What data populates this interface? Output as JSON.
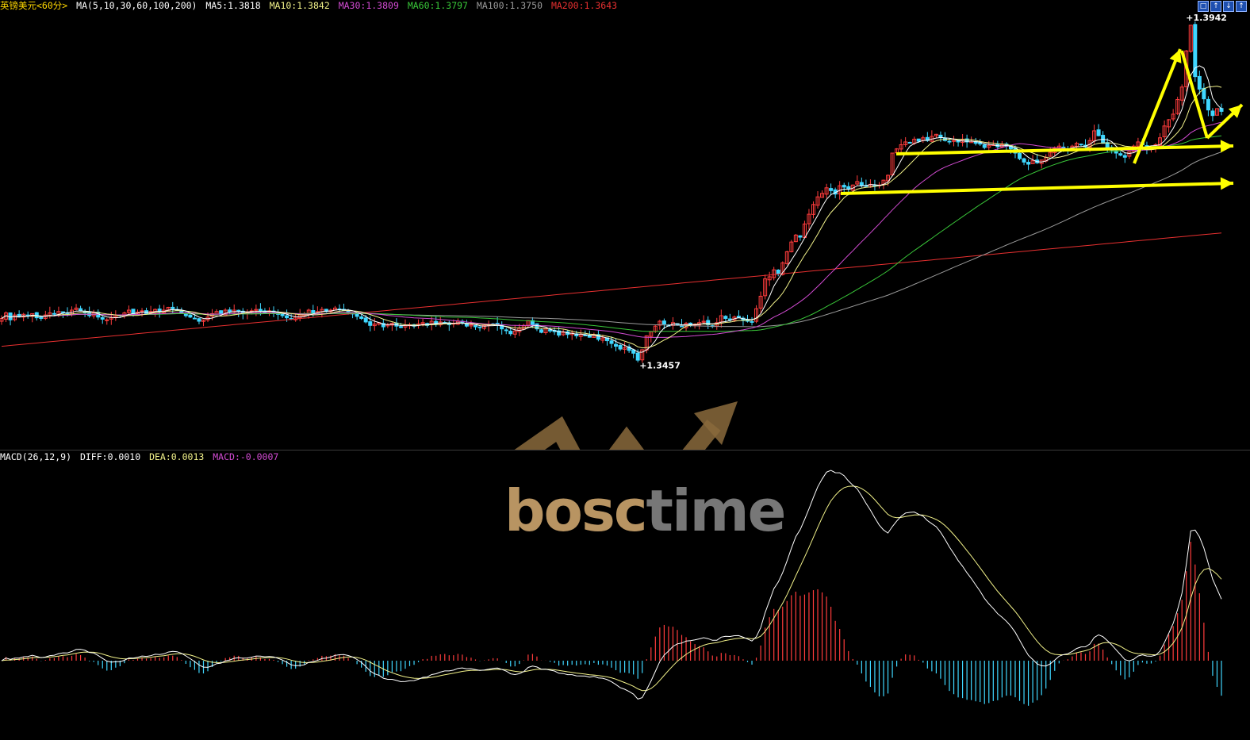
{
  "header": {
    "instrument": "英镑美元<60分>",
    "ma_params": "MA(5,10,30,60,100,200)",
    "ma5": "MA5:1.3818",
    "ma10": "MA10:1.3842",
    "ma30": "MA30:1.3809",
    "ma60": "MA60:1.3797",
    "ma100": "MA100:1.3750",
    "ma200": "MA200:1.3643"
  },
  "macd_header": {
    "params": "MACD(26,12,9)",
    "diff": "DIFF:0.0010",
    "dea": "DEA:0.0013",
    "macd": "MACD:-0.0007"
  },
  "annotations": {
    "high": "1.3942",
    "low": "1.3457"
  },
  "watermark": {
    "text_a": "bosc",
    "text_b": "time"
  },
  "window_buttons": [
    "□",
    "↑",
    "↓",
    "↑"
  ],
  "colors": {
    "up": "#ff3c3c",
    "down": "#3fd7ff",
    "ma5": "#ffffff",
    "ma10": "#f2f28a",
    "ma30": "#d24bd2",
    "ma60": "#39c739",
    "ma100": "#9a9a9a",
    "ma200": "#e83030",
    "annotation_arrows": "#ffff00"
  },
  "chart_data": [
    {
      "type": "candlestick",
      "title": "英镑美元<60分>",
      "ylim": [
        1.333,
        1.396
      ],
      "series": [
        {
          "name": "price",
          "close": [
            1.352,
            1.3528,
            1.3518,
            1.3525,
            1.3522,
            1.3526,
            1.3524,
            1.3527,
            1.3521,
            1.352,
            1.3525,
            1.3528,
            1.3526,
            1.353,
            1.3529,
            1.3527,
            1.3532,
            1.3535,
            1.3531,
            1.3528,
            1.3524,
            1.3528,
            1.3522,
            1.3519,
            1.3518,
            1.3521,
            1.3525,
            1.3524,
            1.3528,
            1.3532,
            1.3526,
            1.3529,
            1.3531,
            1.3527,
            1.353,
            1.3533,
            1.3529,
            1.3532,
            1.3536,
            1.3534,
            1.3532,
            1.3528,
            1.3524,
            1.3522,
            1.352,
            1.3516,
            1.3518,
            1.3522,
            1.3527,
            1.353,
            1.3526,
            1.3532,
            1.3529,
            1.3532,
            1.353,
            1.3527,
            1.3529,
            1.3531,
            1.3533,
            1.353,
            1.3528,
            1.3531,
            1.3529,
            1.3526,
            1.3524,
            1.3521,
            1.3519,
            1.3522,
            1.3525,
            1.3526,
            1.3532,
            1.3528,
            1.353,
            1.3533,
            1.353,
            1.3532,
            1.3535,
            1.3533,
            1.3532,
            1.3529,
            1.3527,
            1.3523,
            1.352,
            1.3515,
            1.351,
            1.3512,
            1.3514,
            1.3508,
            1.3511,
            1.3513,
            1.3509,
            1.3507,
            1.351,
            1.3511,
            1.3509,
            1.3512,
            1.3514,
            1.351,
            1.3516,
            1.3512,
            1.3515,
            1.3514,
            1.3511,
            1.3513,
            1.3516,
            1.3513,
            1.3509,
            1.3511,
            1.3508,
            1.3507,
            1.351,
            1.3511,
            1.3512,
            1.351,
            1.3505,
            1.3503,
            1.3498,
            1.3502,
            1.3506,
            1.351,
            1.3517,
            1.3511,
            1.3505,
            1.35,
            1.3505,
            1.3502,
            1.3501,
            1.3496,
            1.35,
            1.3497,
            1.3499,
            1.3495,
            1.3497,
            1.3496,
            1.3493,
            1.3497,
            1.349,
            1.3492,
            1.3488,
            1.3484,
            1.348,
            1.3476,
            1.3478,
            1.3474,
            1.347,
            1.346,
            1.3475,
            1.3495,
            1.3501,
            1.3509,
            1.3516,
            1.3512,
            1.3509,
            1.3514,
            1.3511,
            1.3508,
            1.3513,
            1.351,
            1.3512,
            1.3514,
            1.3516,
            1.3511,
            1.3509,
            1.3514,
            1.3524,
            1.352,
            1.3518,
            1.3522,
            1.3521,
            1.3517,
            1.3516,
            1.3515,
            1.3534,
            1.3552,
            1.3577,
            1.358,
            1.359,
            1.3584,
            1.36,
            1.3616,
            1.363,
            1.364,
            1.3637,
            1.3656,
            1.367,
            1.3684,
            1.3695,
            1.37,
            1.3708,
            1.3704,
            1.3699,
            1.3711,
            1.3709,
            1.3706,
            1.3712,
            1.3717,
            1.3711,
            1.371,
            1.3713,
            1.3711,
            1.3712,
            1.3719,
            1.3726,
            1.3758,
            1.3764,
            1.377,
            1.3774,
            1.3773,
            1.3778,
            1.3775,
            1.378,
            1.3776,
            1.3782,
            1.3785,
            1.378,
            1.3776,
            1.3774,
            1.3776,
            1.3774,
            1.3777,
            1.3774,
            1.3775,
            1.3772,
            1.3771,
            1.3766,
            1.3769,
            1.377,
            1.3767,
            1.377,
            1.3768,
            1.3764,
            1.3758,
            1.375,
            1.3745,
            1.3742,
            1.3747,
            1.3744,
            1.3748,
            1.3752,
            1.3759,
            1.3765,
            1.3768,
            1.3764,
            1.3763,
            1.3768,
            1.3772,
            1.377,
            1.3767,
            1.3776,
            1.379,
            1.3783,
            1.3772,
            1.3765,
            1.3762,
            1.3758,
            1.3755,
            1.3752,
            1.376,
            1.3768,
            1.3774,
            1.377,
            1.3764,
            1.3766,
            1.377,
            1.378,
            1.3797,
            1.3806,
            1.3814,
            1.3835,
            1.3853,
            1.3905,
            1.3942,
            1.3868,
            1.385,
            1.3836,
            1.382,
            1.3812,
            1.3822,
            1.3818
          ],
          "low": 1.3457,
          "high": 1.3942
        }
      ],
      "moving_averages": [
        "MA5",
        "MA10",
        "MA30",
        "MA60",
        "MA100",
        "MA200"
      ]
    },
    {
      "type": "macd",
      "title": "MACD(26,12,9)",
      "series": [
        {
          "name": "DIFF",
          "last": 0.001
        },
        {
          "name": "DEA",
          "last": 0.0013
        },
        {
          "name": "MACD",
          "last": -0.0007
        }
      ]
    }
  ]
}
